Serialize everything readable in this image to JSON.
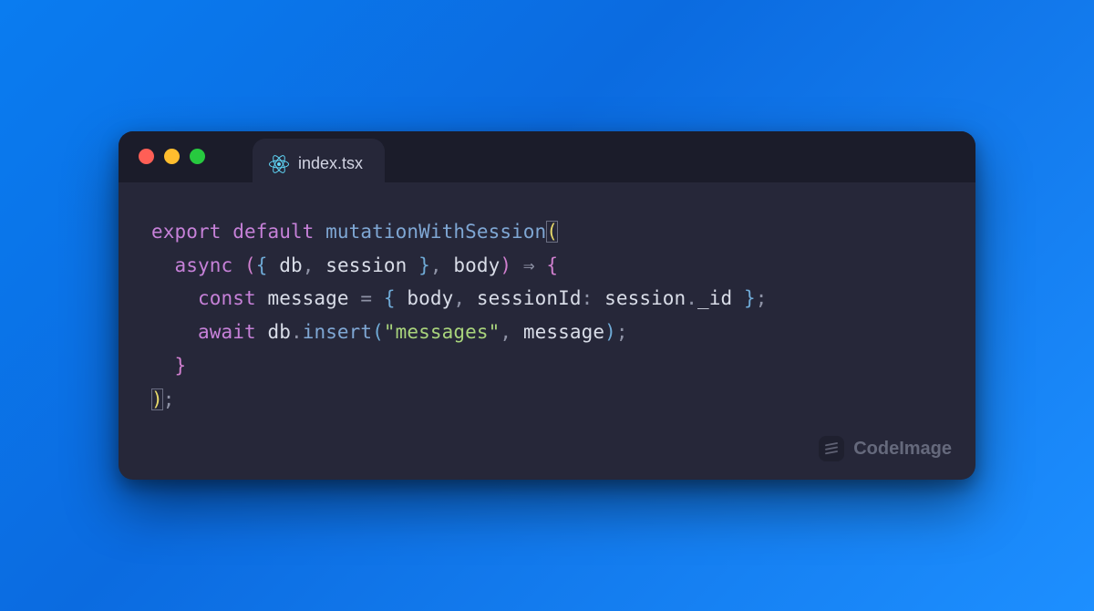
{
  "tab": {
    "filename": "index.tsx",
    "icon": "react-icon"
  },
  "traffic": {
    "close": "red",
    "minimize": "yellow",
    "zoom": "green"
  },
  "watermark": {
    "text": "CodeImage"
  },
  "code": {
    "tokens": {
      "export": "export",
      "default": "default",
      "fn_name": "mutationWithSession",
      "open_paren_1": "(",
      "async": "async",
      "open_paren_2": "(",
      "open_brace_destr": "{",
      "db": "db",
      "comma1": ",",
      "session": "session",
      "close_brace_destr": "}",
      "comma2": ",",
      "body_param": "body",
      "close_paren_2": ")",
      "arrow": "⇒",
      "open_brace_fn": "{",
      "const": "const",
      "message_var": "message",
      "eq": "=",
      "open_brace_obj": "{",
      "body_key": "body",
      "comma3": ",",
      "sessionId_key": "sessionId",
      "colon": ":",
      "session_ref": "session",
      "dot1": ".",
      "id_prop": "_id",
      "close_brace_obj": "}",
      "semi1": ";",
      "await": "await",
      "db_ref": "db",
      "dot2": ".",
      "insert": "insert",
      "open_paren_call": "(",
      "str_messages": "\"messages\"",
      "comma4": ",",
      "message_ref": "message",
      "close_paren_call": ")",
      "semi2": ";",
      "close_brace_fn": "}",
      "close_paren_1": ")",
      "semi3": ";"
    }
  }
}
